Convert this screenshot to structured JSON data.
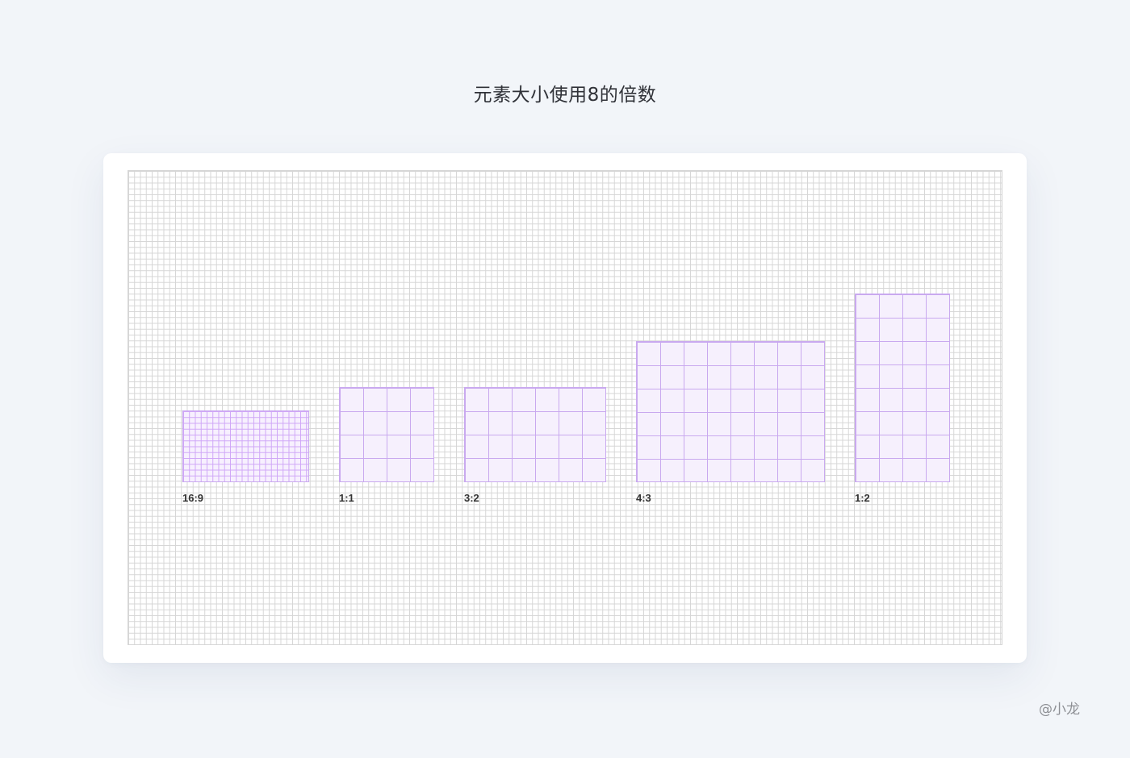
{
  "title": "元素大小使用8的倍数",
  "ratios": [
    {
      "label": "16:9"
    },
    {
      "label": "1:1"
    },
    {
      "label": "3:2"
    },
    {
      "label": "4:3"
    },
    {
      "label": "1:2"
    }
  ],
  "watermark": "@小龙",
  "colors": {
    "background": "#f2f5f9",
    "grid_line": "#d6d6d6",
    "box_fill": "#f6f0fd",
    "box_line": "#c9a9ef"
  }
}
